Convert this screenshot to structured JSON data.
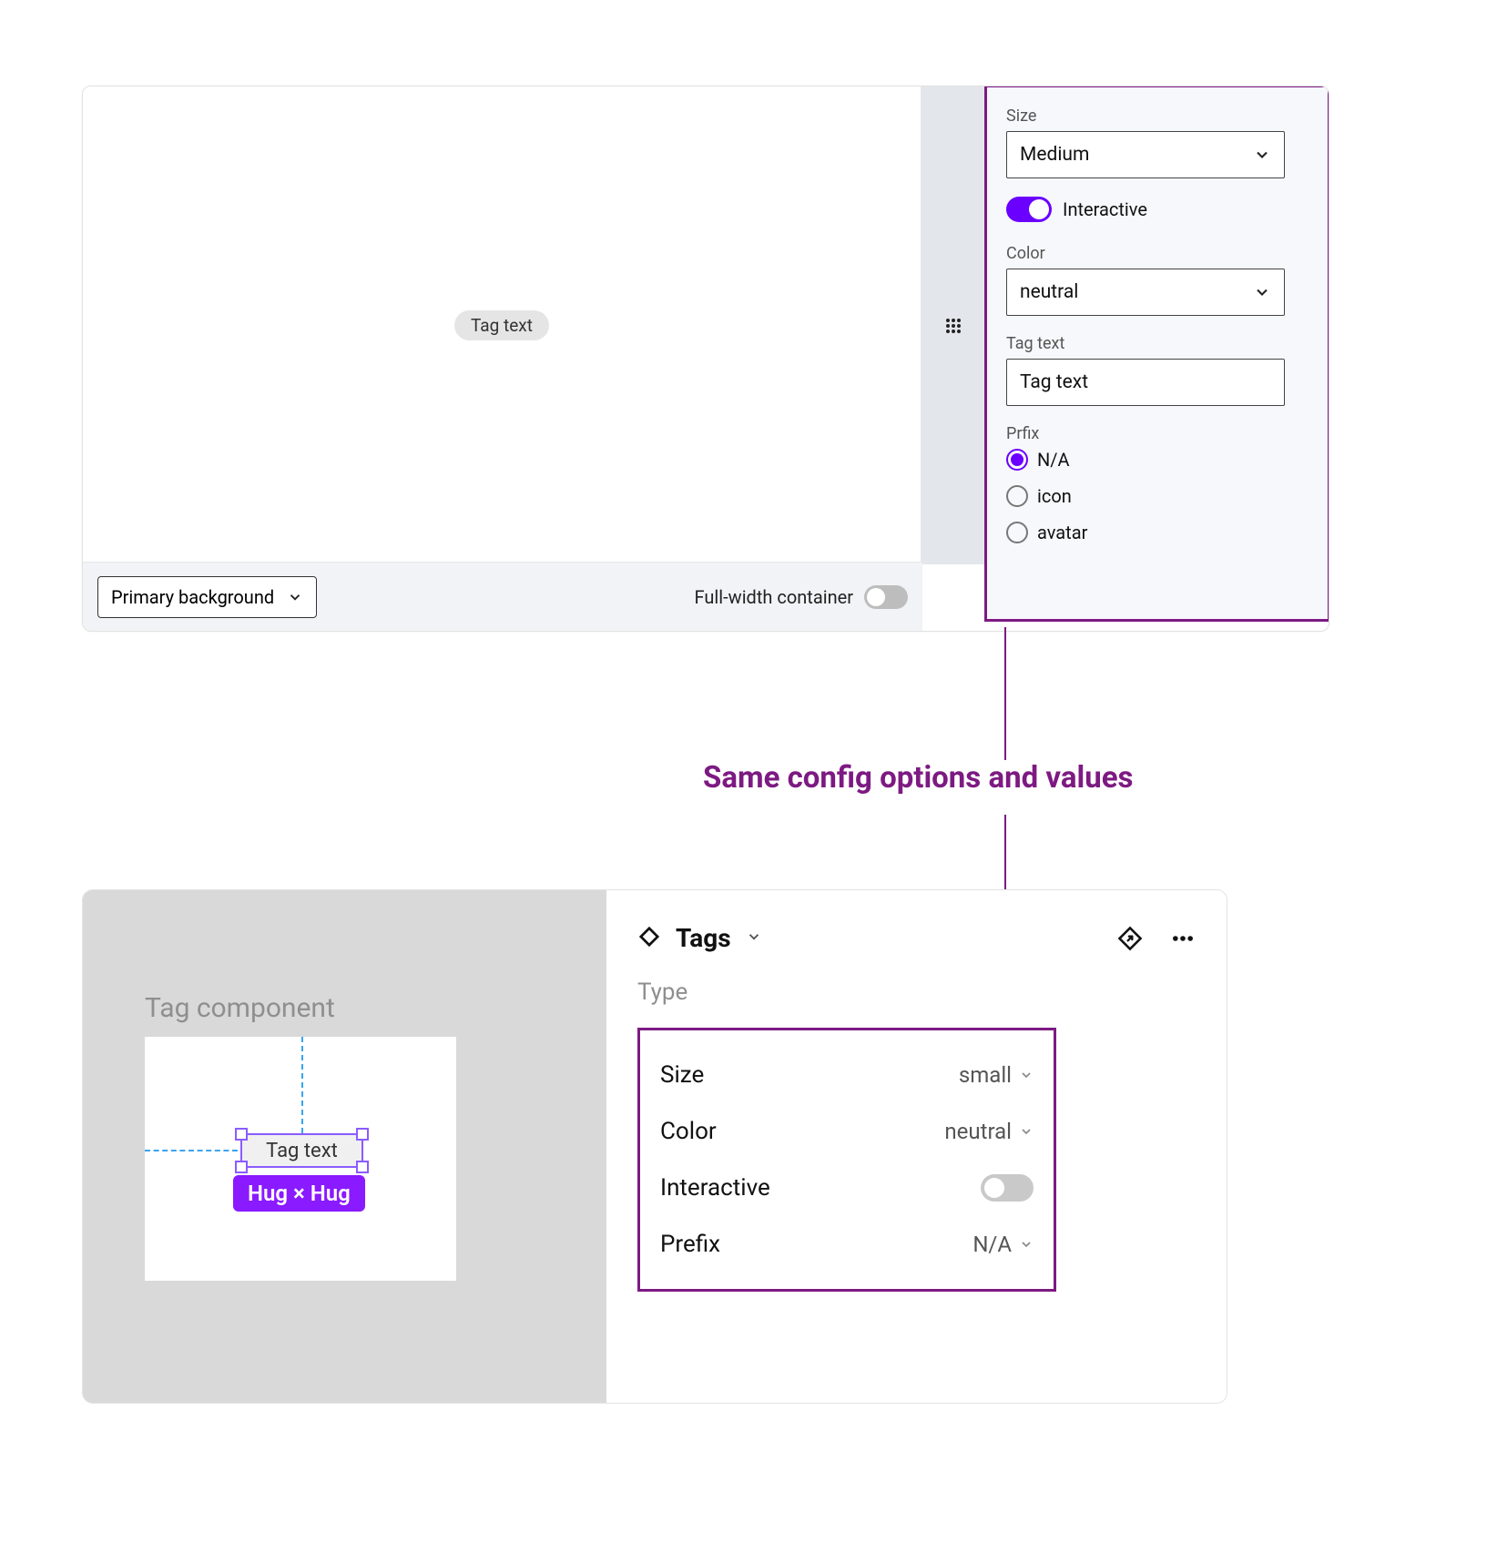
{
  "annotation": {
    "text": "Same config options and values"
  },
  "panel1": {
    "preview_tag_text": "Tag text",
    "sidebar": {
      "size": {
        "label": "Size",
        "value": "Medium"
      },
      "interactive": {
        "label": "Interactive"
      },
      "color": {
        "label": "Color",
        "value": "neutral"
      },
      "tagtext": {
        "label": "Tag text",
        "value": "Tag text"
      },
      "prefix": {
        "label": "Prfix",
        "options": [
          "N/A",
          "icon",
          "avatar"
        ],
        "selected": "N/A"
      }
    },
    "footer": {
      "bg_select": "Primary background",
      "fullwidth_label": "Full-width container"
    }
  },
  "panel2": {
    "left": {
      "section_title": "Tag component",
      "selected_tag_text": "Tag text",
      "constraint_badge": "Hug × Hug"
    },
    "right": {
      "component_name": "Tags",
      "type_label": "Type",
      "rows": {
        "size": {
          "label": "Size",
          "value": "small"
        },
        "color": {
          "label": "Color",
          "value": "neutral"
        },
        "interactive": {
          "label": "Interactive"
        },
        "prefix": {
          "label": "Prefix",
          "value": "N/A"
        }
      }
    }
  }
}
